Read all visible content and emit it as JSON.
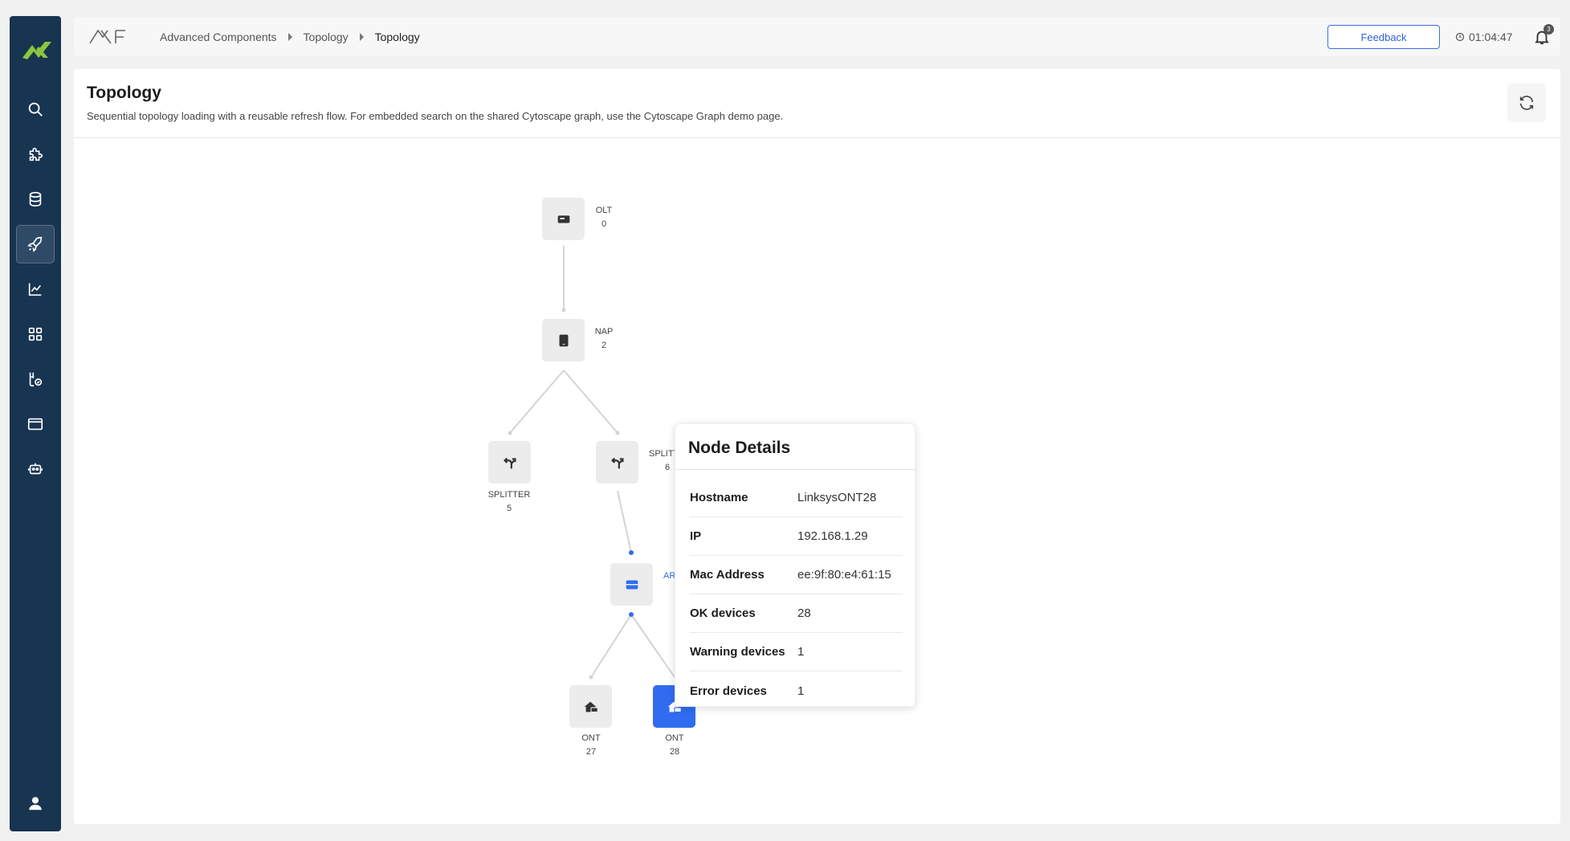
{
  "app": {
    "brand": "XF"
  },
  "sidebar": {
    "items": [
      {
        "icon": "search-icon",
        "active": false
      },
      {
        "icon": "puzzle-icon",
        "active": false
      },
      {
        "icon": "database-icon",
        "active": false
      },
      {
        "icon": "rocket-icon",
        "active": true
      },
      {
        "icon": "chart-line-icon",
        "active": false
      },
      {
        "icon": "grid-icon",
        "active": false
      },
      {
        "icon": "flask-check-icon",
        "active": false
      },
      {
        "icon": "browser-window-icon",
        "active": false
      },
      {
        "icon": "robot-icon",
        "active": false
      },
      {
        "icon": "user-icon",
        "active": false
      }
    ]
  },
  "breadcrumb": [
    "Advanced Components",
    "Topology",
    "Topology"
  ],
  "topbar": {
    "feedback_label": "Feedback",
    "timer": "01:04:47",
    "notification_count": "3"
  },
  "page": {
    "title": "Topology",
    "description": "Sequential topology loading with a reusable refresh flow. For embedded search on the shared Cytoscape graph, use the Cytoscape Graph demo page."
  },
  "topology": {
    "nodes": [
      {
        "type": "OLT",
        "count": "0",
        "icon": "server-icon",
        "selected": false
      },
      {
        "type": "NAP",
        "count": "2",
        "icon": "tablet-icon",
        "selected": false
      },
      {
        "type": "SPLITTER",
        "count": "5",
        "icon": "split-arrow-icon",
        "selected": false
      },
      {
        "type": "SPLITT",
        "count": "6",
        "icon": "split-arrow-icon",
        "selected": false
      },
      {
        "type": "AR",
        "count": "",
        "icon": "drive-icon",
        "selected": false
      },
      {
        "type": "ONT",
        "count": "27",
        "icon": "home-network-icon",
        "selected": false
      },
      {
        "type": "ONT",
        "count": "28",
        "icon": "home-network-icon",
        "selected": true
      }
    ]
  },
  "node_details": {
    "title": "Node Details",
    "rows": [
      {
        "key": "Hostname",
        "value": "LinksysONT28"
      },
      {
        "key": "IP",
        "value": "192.168.1.29"
      },
      {
        "key": "Mac Address",
        "value": "ee:9f:80:e4:61:15"
      },
      {
        "key": "OK devices",
        "value": "28"
      },
      {
        "key": "Warning devices",
        "value": "1"
      },
      {
        "key": "Error devices",
        "value": "1"
      }
    ]
  },
  "colors": {
    "sidebar": "#173451",
    "accent": "#2f6cf0",
    "logo_green": "#8cc63f"
  }
}
